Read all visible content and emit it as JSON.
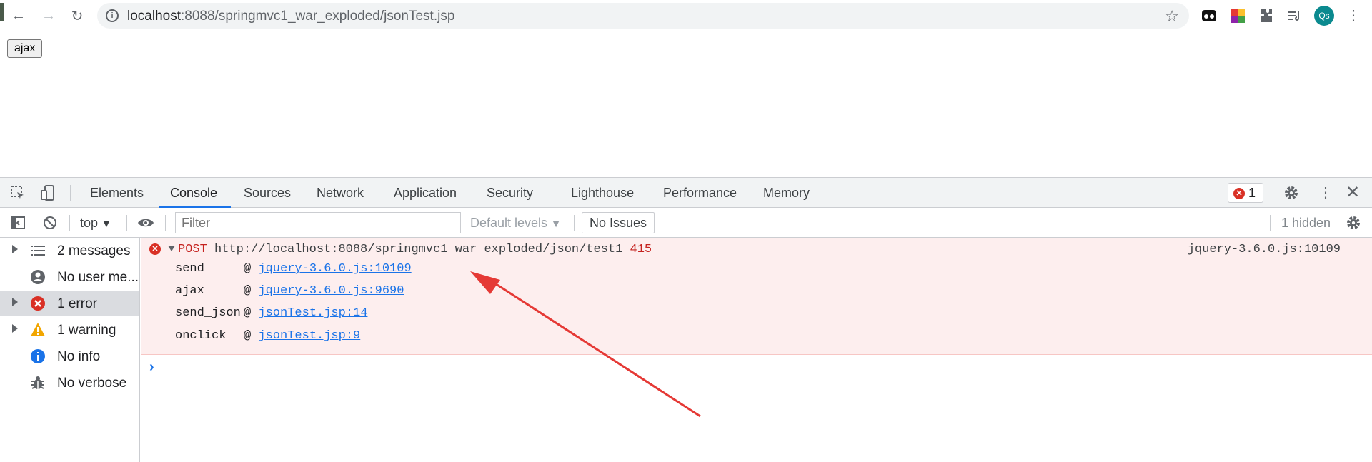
{
  "browser": {
    "url_host": "localhost",
    "url_rest": ":8088/springmvc1_war_exploded/jsonTest.jsp",
    "avatar": "Qs"
  },
  "page": {
    "button_label": "ajax"
  },
  "devtools": {
    "tabs": [
      "Elements",
      "Console",
      "Sources",
      "Network",
      "Application",
      "Security",
      "Lighthouse",
      "Performance",
      "Memory"
    ],
    "error_count": "1",
    "console_bar": {
      "context": "top",
      "filter_placeholder": "Filter",
      "levels": "Default levels",
      "no_issues": "No Issues",
      "hidden": "1 hidden"
    },
    "sidebar": [
      {
        "label": "2 messages",
        "icon": "list-icon"
      },
      {
        "label": "No user me...",
        "icon": "user-icon"
      },
      {
        "label": "1 error",
        "icon": "error-icon"
      },
      {
        "label": "1 warning",
        "icon": "warning-icon"
      },
      {
        "label": "No info",
        "icon": "info-icon"
      },
      {
        "label": "No verbose",
        "icon": "bug-icon"
      }
    ],
    "error": {
      "method": "POST",
      "url": "http://localhost:8088/springmvc1_war_exploded/json/test1",
      "status": "415",
      "source": "jquery-3.6.0.js:10109",
      "stack": [
        {
          "fn": "send",
          "at": "@",
          "loc": "jquery-3.6.0.js:10109"
        },
        {
          "fn": "ajax",
          "at": "@",
          "loc": "jquery-3.6.0.js:9690"
        },
        {
          "fn": "send_json",
          "at": "@",
          "loc": "jsonTest.jsp:14"
        },
        {
          "fn": "onclick",
          "at": "@",
          "loc": "jsonTest.jsp:9"
        }
      ]
    },
    "colors": {
      "accent": "#1a73e8",
      "error": "#d93025",
      "error_bg": "#fdeeee",
      "annotation": "#e53935"
    }
  }
}
